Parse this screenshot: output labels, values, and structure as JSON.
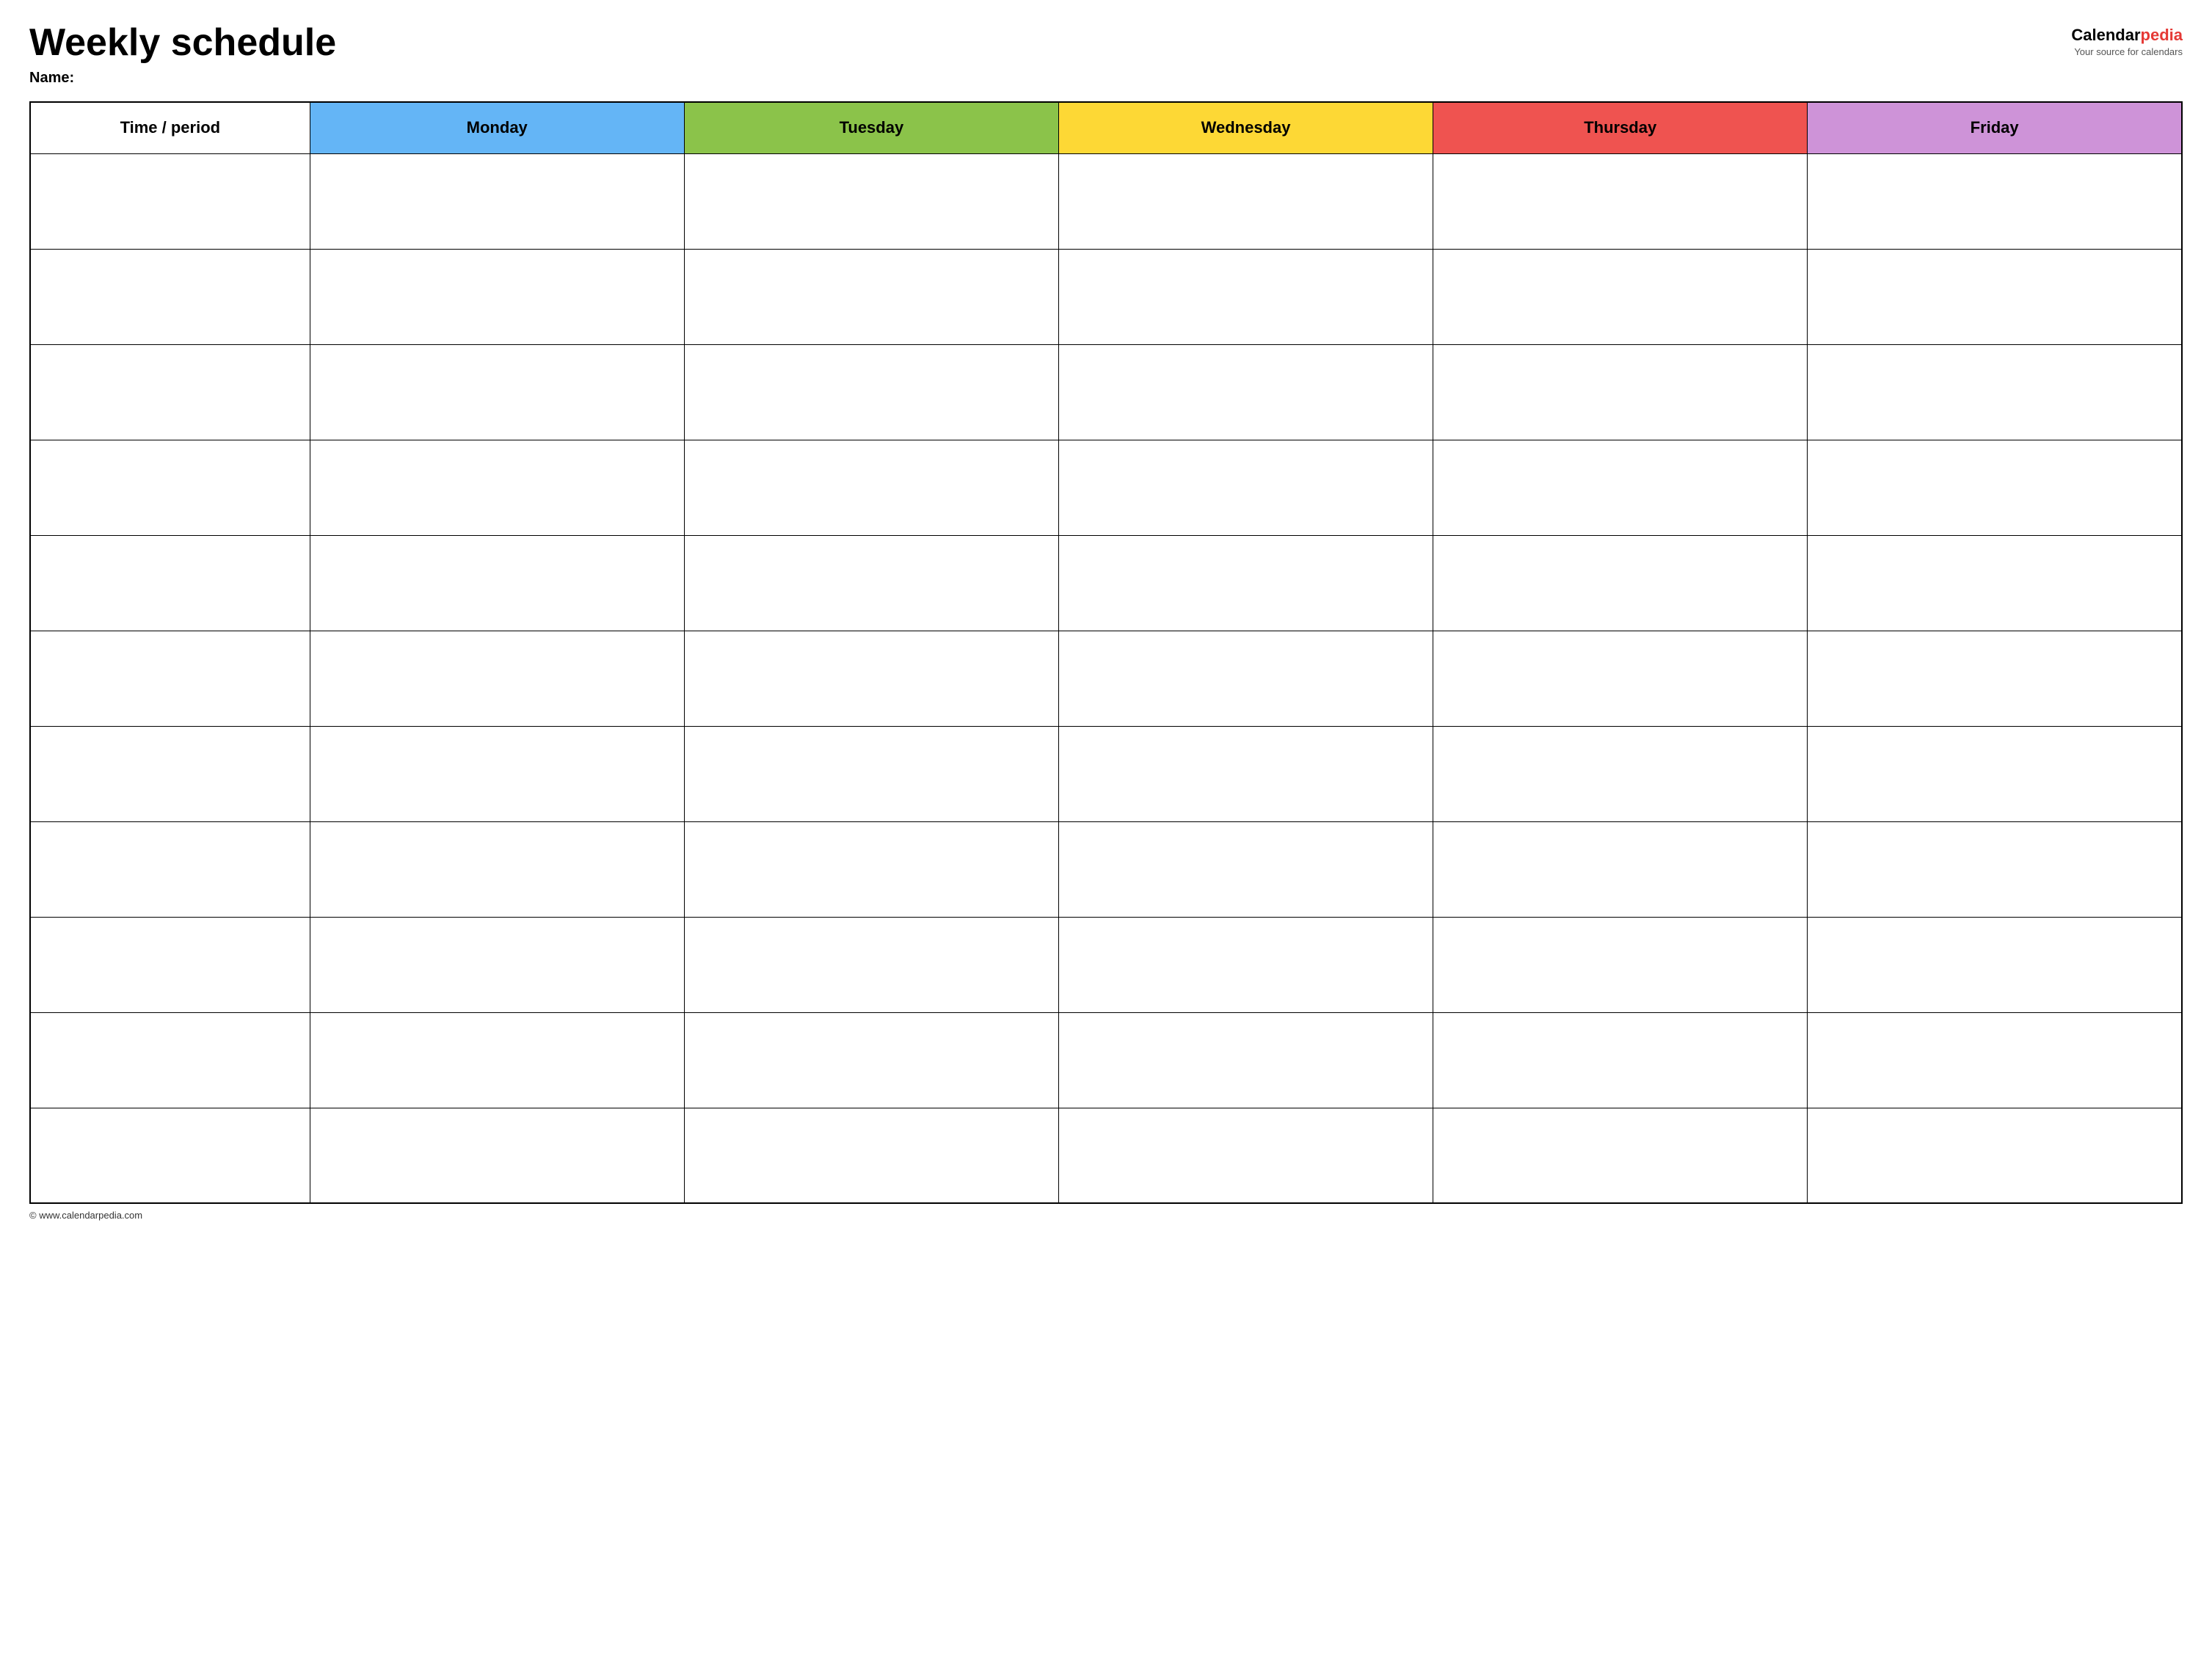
{
  "header": {
    "title": "Weekly schedule",
    "name_label": "Name:",
    "logo": {
      "brand_part1": "Calendar",
      "brand_part2": "pedia",
      "tagline": "Your source for calendars"
    }
  },
  "table": {
    "columns": {
      "time_period": "Time / period",
      "monday": "Monday",
      "tuesday": "Tuesday",
      "wednesday": "Wednesday",
      "thursday": "Thursday",
      "friday": "Friday"
    },
    "row_count": 11
  },
  "footer": {
    "copyright": "© www.calendarpedia.com"
  }
}
